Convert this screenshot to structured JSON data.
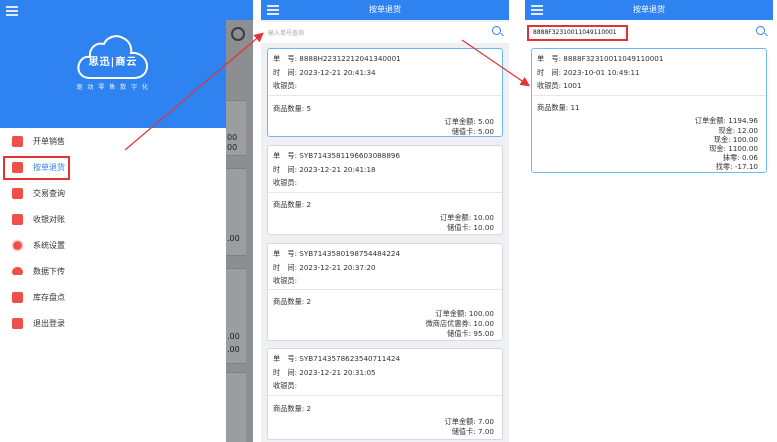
{
  "drawer": {
    "logo_text": "思迅|商云",
    "tagline": "驱 动 零 售 数 字 化",
    "menu": [
      {
        "label": "开单销售",
        "icon": "cart-icon"
      },
      {
        "label": "按单退货",
        "icon": "return-order-icon"
      },
      {
        "label": "交易查询",
        "icon": "transaction-query-icon"
      },
      {
        "label": "收银对账",
        "icon": "reconcile-icon"
      },
      {
        "label": "系统设置",
        "icon": "gear-icon"
      },
      {
        "label": "数据下传",
        "icon": "cloud-download-icon"
      },
      {
        "label": "库存盘点",
        "icon": "inventory-icon"
      },
      {
        "label": "退出登录",
        "icon": "logout-icon"
      }
    ],
    "active_index": 1,
    "background_peek": [
      "00",
      "00",
      ".00",
      ".00",
      ".00"
    ]
  },
  "list_screen": {
    "title": "按单退货",
    "search_placeholder": "输入单号查询",
    "labels": {
      "order_no": "单　号: ",
      "time": "时　间: ",
      "cashier": "收银员: ",
      "item_count": "商品数量: "
    },
    "orders": [
      {
        "order_no": "8888H22312212041340001",
        "time": "2023-12-21 20:41:34",
        "cashier": "",
        "item_count": "5",
        "payments": [
          {
            "label": "订单金额: ",
            "value": "5.00"
          },
          {
            "label": "储值卡: ",
            "value": "5.00"
          }
        ]
      },
      {
        "order_no": "SYB7143581196603088896",
        "time": "2023-12-21 20:41:18",
        "cashier": "",
        "item_count": "2",
        "payments": [
          {
            "label": "订单金额: ",
            "value": "10.00"
          },
          {
            "label": "储值卡: ",
            "value": "10.00"
          }
        ]
      },
      {
        "order_no": "SYB7143580198754484224",
        "time": "2023-12-21 20:37:20",
        "cashier": "",
        "item_count": "2",
        "payments": [
          {
            "label": "订单金额: ",
            "value": "100.00"
          },
          {
            "label": "微商店优惠券: ",
            "value": "10.00"
          },
          {
            "label": "储值卡: ",
            "value": "95.00"
          }
        ]
      },
      {
        "order_no": "SYB7143578623540711424",
        "time": "2023-12-21 20:31:05",
        "cashier": "",
        "item_count": "2",
        "payments": [
          {
            "label": "订单金额: ",
            "value": "7.00"
          },
          {
            "label": "储值卡: ",
            "value": "7.00"
          }
        ]
      }
    ]
  },
  "result_screen": {
    "title": "按单退货",
    "search_value": "8888F32310011049110001",
    "order": {
      "order_no": "8888F32310011049110001",
      "time": "2023-10-01 10:49:11",
      "cashier": "1001",
      "item_count": "11",
      "payments": [
        {
          "label": "订单金额: ",
          "value": "1194.96"
        },
        {
          "label": "现金: ",
          "value": "12.00"
        },
        {
          "label": "现金: ",
          "value": "100.00"
        },
        {
          "label": "现金: ",
          "value": "1100.00"
        },
        {
          "label": "抹零: ",
          "value": "0.06"
        },
        {
          "label": "找零: ",
          "value": "-17.10"
        }
      ]
    }
  },
  "colors": {
    "brand_blue": "#2f83f0",
    "menu_icon_red": "#ef4e49",
    "annotation_red": "#e23232",
    "selected_card_border": "#6db8ec"
  }
}
